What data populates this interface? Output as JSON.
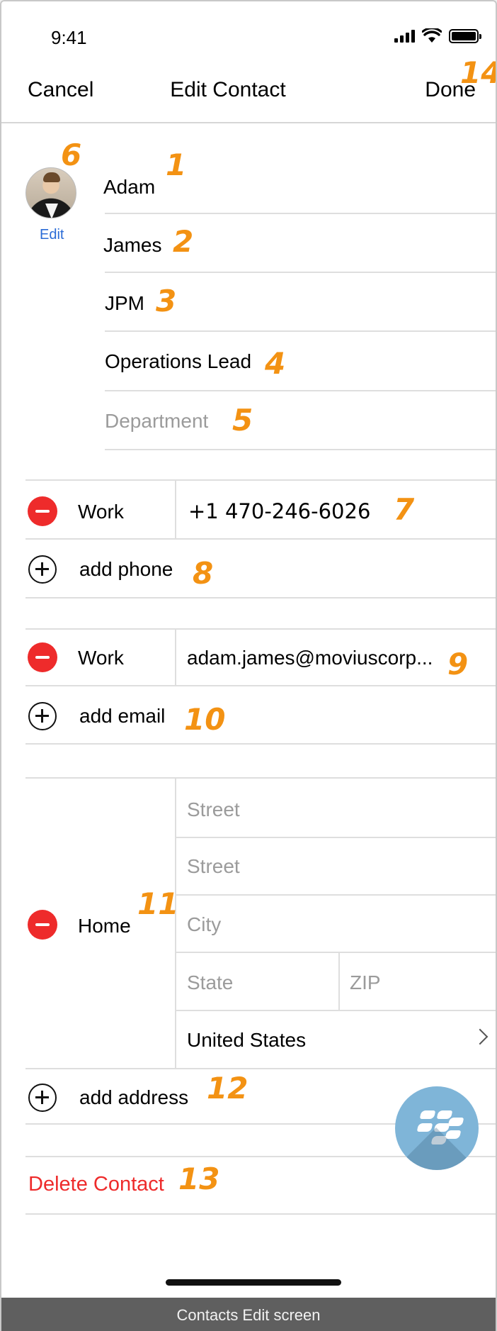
{
  "status_bar": {
    "time": "9:41"
  },
  "nav": {
    "cancel": "Cancel",
    "title": "Edit Contact",
    "done": "Done"
  },
  "avatar": {
    "edit_label": "Edit"
  },
  "name_fields": {
    "first": "Adam",
    "last": "James",
    "company": "JPM",
    "job_title": "Operations Lead",
    "department_placeholder": "Department"
  },
  "phone": {
    "label": "Work",
    "value": "+1 470-246-6026",
    "add_label": "add phone"
  },
  "email": {
    "label": "Work",
    "value": "adam.james@moviuscorp...",
    "add_label": "add email"
  },
  "address": {
    "label": "Home",
    "street1_placeholder": "Street",
    "street2_placeholder": "Street",
    "city_placeholder": "City",
    "state_placeholder": "State",
    "zip_placeholder": "ZIP",
    "country": "United States",
    "add_label": "add address"
  },
  "delete_label": "Delete Contact",
  "annotations": [
    "1",
    "2",
    "3",
    "4",
    "5",
    "6",
    "7",
    "8",
    "9",
    "10",
    "11",
    "12",
    "13",
    "14"
  ],
  "caption": "Contacts Edit screen",
  "colors": {
    "accent_orange": "#f39213",
    "destructive_red": "#ee2b2b",
    "link_blue": "#2a6bd6",
    "bb_blue": "#7fb5d8"
  }
}
